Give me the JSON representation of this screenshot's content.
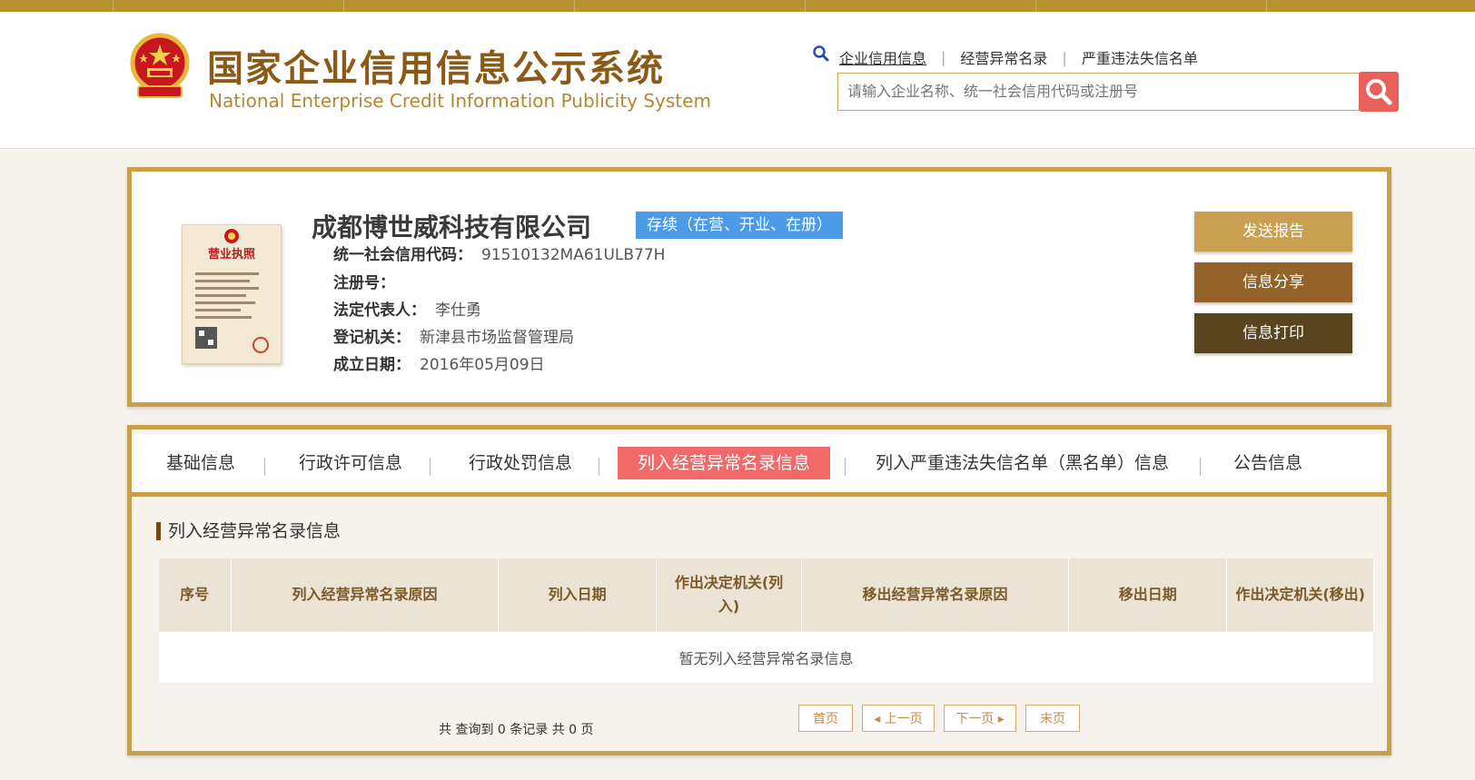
{
  "header": {
    "title_cn": "国家企业信用信息公示系统",
    "title_en": "National Enterprise Credit Information Publicity System",
    "links": [
      "企业信用信息",
      "经营异常名录",
      "严重违法失信名单"
    ],
    "search_placeholder": "请输入企业名称、统一社会信用代码或注册号"
  },
  "company": {
    "name": "成都博世威科技有限公司",
    "status": "存续（在营、开业、在册）",
    "license_title": "营业执照",
    "fields": [
      {
        "label": "统一社会信用代码：",
        "value": "91510132MA61ULB77H"
      },
      {
        "label": "注册号：",
        "value": ""
      },
      {
        "label": "法定代表人：",
        "value": "李仕勇"
      },
      {
        "label": "登记机关：",
        "value": "新津县市场监督管理局"
      },
      {
        "label": "成立日期：",
        "value": "2016年05月09日"
      }
    ],
    "actions": [
      "发送报告",
      "信息分享",
      "信息打印"
    ]
  },
  "tabs": [
    "基础信息",
    "行政许可信息",
    "行政处罚信息",
    "列入经营异常名录信息",
    "列入严重违法失信名单（黑名单）信息",
    "公告信息"
  ],
  "section": {
    "title": "列入经营异常名录信息",
    "columns": [
      "序号",
      "列入经营异常名录原因",
      "列入日期",
      "作出决定机关(列入)",
      "移出经营异常名录原因",
      "移出日期",
      "作出决定机关(移出)"
    ],
    "empty_text": "暂无列入经营异常名录信息"
  },
  "pager": {
    "summary": "共 查询到 0 条记录 共 0 页",
    "first": "首页",
    "prev": "上一页",
    "next": "下一页",
    "last": "末页"
  },
  "colors": {
    "accent": "#c9a046",
    "active_tab": "#f16a69",
    "status_badge": "#4a9be8"
  }
}
